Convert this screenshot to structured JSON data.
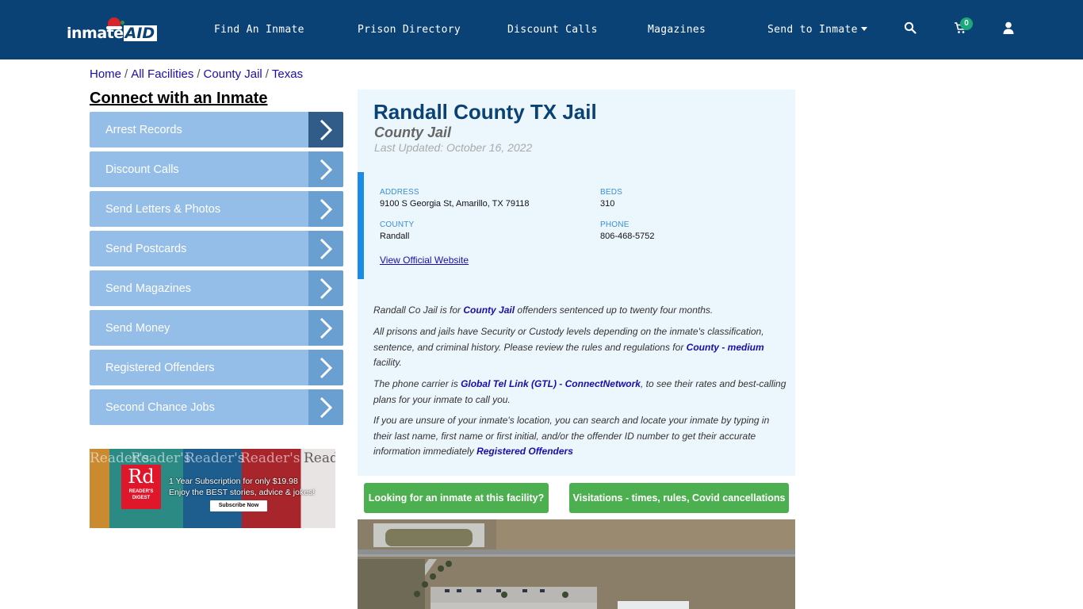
{
  "nav": {
    "logo_text": "inmate",
    "logo_accent": "AID",
    "links": [
      "Find An Inmate",
      "Prison Directory",
      "Discount Calls",
      "Magazines",
      "Send to Inmate"
    ],
    "cart_count": "0",
    "icons": [
      "search-icon",
      "cart-icon",
      "user-icon"
    ]
  },
  "breadcrumb": [
    "Home",
    "All Facilities",
    "County Jail",
    "Texas"
  ],
  "sidebar": {
    "title": "Connect with an Inmate",
    "items": [
      {
        "label": "Arrest Records",
        "active": true
      },
      {
        "label": "Discount Calls"
      },
      {
        "label": "Send Letters & Photos"
      },
      {
        "label": "Send Postcards"
      },
      {
        "label": "Send Magazines"
      },
      {
        "label": "Send Money"
      },
      {
        "label": "Registered Offenders"
      },
      {
        "label": "Second Chance Jobs"
      }
    ]
  },
  "ad": {
    "brand": "Rd",
    "brand_sub": "READER'S DIGEST",
    "mag_title": "Reader's",
    "line1": "1 Year Subscription for only $19.98",
    "line2": "Enjoy the BEST stories, advice & jokes!",
    "cta": "Subscribe Now"
  },
  "facility": {
    "name": "Randall County TX Jail",
    "type": "County Jail",
    "last_updated": "Last Updated: October 16, 2022",
    "address_label": "ADDRESS",
    "address": "9100 S Georgia St, Amarillo, TX 79118",
    "beds_label": "BEDS",
    "beds": "310",
    "county_label": "COUNTY",
    "county": "Randall",
    "phone_label": "PHONE",
    "phone": "806-468-5752",
    "website_link": "View Official Website"
  },
  "description": {
    "p1_a": "Randall Co Jail is for ",
    "p1_link": "County Jail",
    "p1_b": " offenders sentenced up to twenty four months.",
    "p2_a": "All prisons and jails have Security or Custody levels depending on the inmate's classification, sentence, and criminal history. Please review the rules and regulations for ",
    "p2_link": "County - medium",
    "p2_b": " facility.",
    "p3_a": "The phone carrier is ",
    "p3_link": "Global Tel Link (GTL) - ConnectNetwork",
    "p3_b": ", to see their rates and best-calling plans for your inmate to call you.",
    "p4_a": "If you are unsure of your inmate's location, you can search and locate your inmate by typing in their last name, first name or first initial, and/or the offender ID number to get their accurate information immediately ",
    "p4_link": "Registered Offenders"
  },
  "buttons": {
    "find_inmate": "Looking for an inmate at this facility?",
    "visitations": "Visitations - times, rules, Covid cancellations"
  },
  "colors": {
    "nav_bg": "#0b4276",
    "sidebar_item": "#94bde8",
    "chevron_box": "#6a9fd2",
    "chevron_active": "#315b88",
    "card_bg": "#ecf6fd",
    "accent_bar": "#1a8be6",
    "green_button": "#4caf50"
  }
}
